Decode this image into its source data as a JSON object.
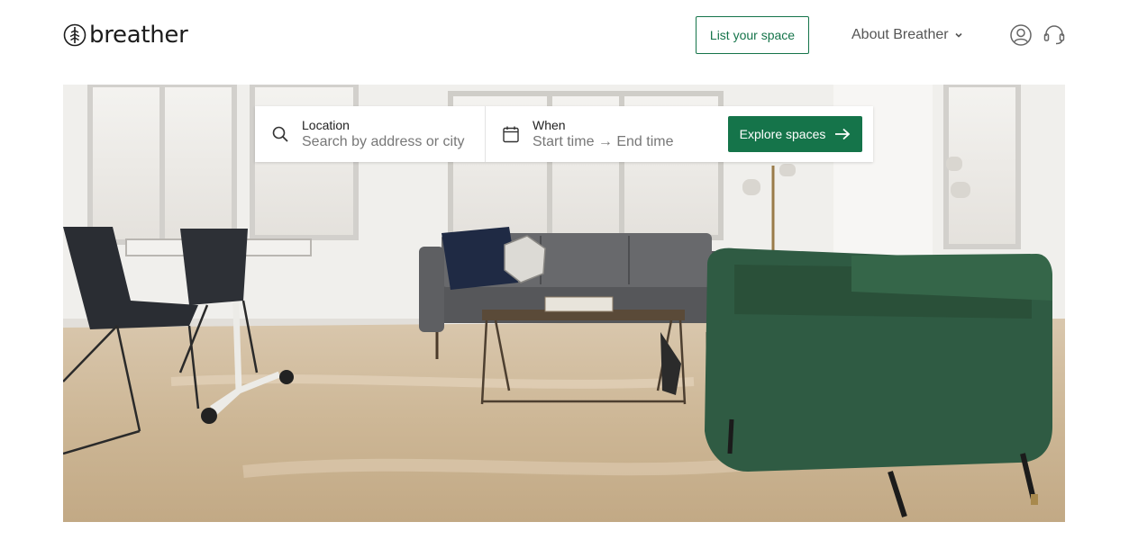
{
  "header": {
    "logo_text": "breather",
    "list_space_label": "List your space",
    "about_label": "About Breather",
    "icons": {
      "account": "user-circle-icon",
      "support": "headset-icon",
      "about_dropdown": "chevron-down-icon"
    }
  },
  "search": {
    "location": {
      "label": "Location",
      "placeholder": "Search by address or city",
      "icon": "search-icon"
    },
    "when": {
      "label": "When",
      "placeholder": "Start time → End time",
      "icon": "calendar-icon"
    },
    "explore_label": "Explore spaces",
    "explore_icon": "arrow-right-icon"
  },
  "hero": {
    "icon": "office-lounge-photo"
  },
  "colors": {
    "brand_green": "#15744a",
    "chair_green": "#2f5b43",
    "text_gray": "#777777"
  }
}
